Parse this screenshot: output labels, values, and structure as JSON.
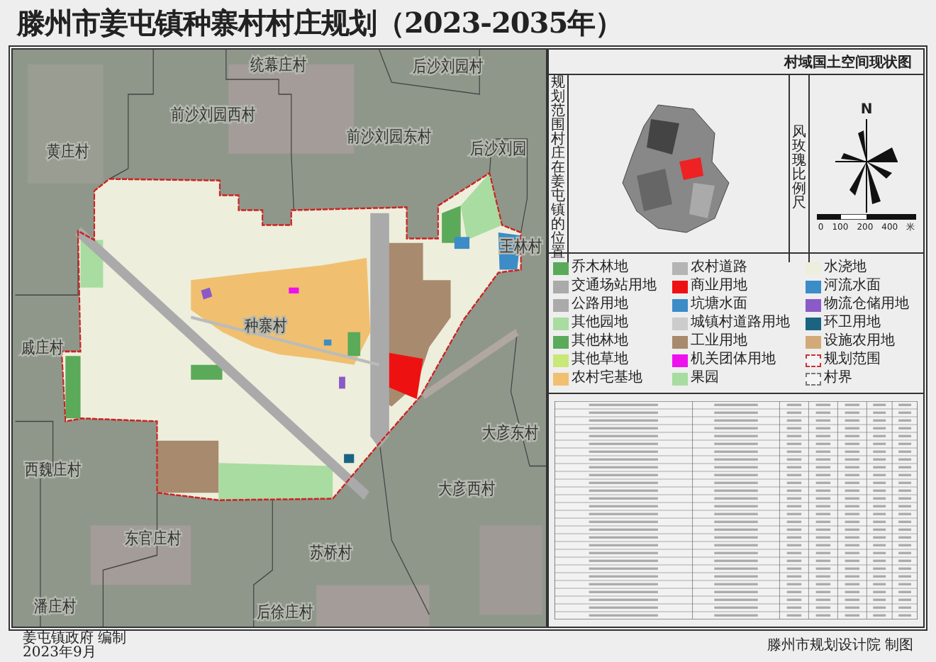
{
  "title": "滕州市姜屯镇种寨村村庄规划（2023-2035年）",
  "subtitle": "村域国土空间现状图",
  "map": {
    "villages": [
      "统幕庄村",
      "后沙刘园村",
      "前沙刘园西村",
      "前沙刘园东村",
      "黄庄村",
      "后沙刘园",
      "王林村",
      "种寨村",
      "戚庄村",
      "西魏庄村",
      "大彦东村",
      "大彦西村",
      "东官庄村",
      "苏桥村",
      "后徐庄村",
      "潘庄村"
    ]
  },
  "locator": {
    "label": "规划范围村庄在姜屯镇的位置"
  },
  "wind_scale": {
    "label": "风玫瑰比例尺",
    "north": "N",
    "scale_ticks": [
      "0",
      "100",
      "200",
      "400"
    ],
    "unit": "米"
  },
  "legend": [
    {
      "label": "乔木林地",
      "color": "#5aaa5a",
      "kind": "fill"
    },
    {
      "label": "农村道路",
      "color": "#b4b4b4",
      "kind": "fill"
    },
    {
      "label": "水浇地",
      "color": "#eeeedc",
      "kind": "fill"
    },
    {
      "label": "交通场站用地",
      "color": "#aaaaaa",
      "kind": "fill"
    },
    {
      "label": "商业用地",
      "color": "#ee1111",
      "kind": "fill"
    },
    {
      "label": "河流水面",
      "color": "#3c8cc8",
      "kind": "fill"
    },
    {
      "label": "公路用地",
      "color": "#aaaaaa",
      "kind": "fill"
    },
    {
      "label": "坑塘水面",
      "color": "#3c8cc8",
      "kind": "fill"
    },
    {
      "label": "物流仓储用地",
      "color": "#8a5ac8",
      "kind": "fill"
    },
    {
      "label": "其他园地",
      "color": "#a8dca0",
      "kind": "fill"
    },
    {
      "label": "城镇村道路用地",
      "color": "#cccccc",
      "kind": "fill"
    },
    {
      "label": "环卫用地",
      "color": "#1a6482",
      "kind": "fill"
    },
    {
      "label": "其他林地",
      "color": "#5aaa5a",
      "kind": "fill"
    },
    {
      "label": "工业用地",
      "color": "#a88a6e",
      "kind": "fill"
    },
    {
      "label": "设施农用地",
      "color": "#d2aa78",
      "kind": "fill"
    },
    {
      "label": "其他草地",
      "color": "#c8e878",
      "kind": "fill"
    },
    {
      "label": "机关团体用地",
      "color": "#ee11ee",
      "kind": "fill"
    },
    {
      "label": "规划范围",
      "color": "#cc3333",
      "kind": "outline"
    },
    {
      "label": "农村宅基地",
      "color": "#f0c070",
      "kind": "fill"
    },
    {
      "label": "果园",
      "color": "#a8dca0",
      "kind": "fill"
    },
    {
      "label": "村界",
      "color": "#777777",
      "kind": "outline"
    }
  ],
  "footer": {
    "left": [
      "姜屯镇政府 编制",
      "2023年9月"
    ],
    "right": "滕州市规划设计院 制图"
  }
}
